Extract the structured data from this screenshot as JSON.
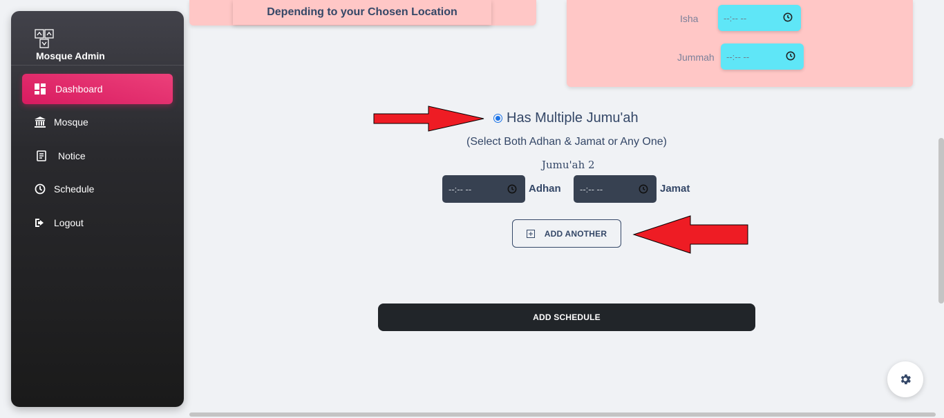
{
  "sidebar": {
    "brand": "Mosque Admin",
    "items": [
      {
        "label": "Dashboard",
        "icon": "dashboard-icon",
        "active": true
      },
      {
        "label": "Mosque",
        "icon": "mosque-icon",
        "active": false
      },
      {
        "label": "Notice",
        "icon": "notice-icon",
        "active": false
      },
      {
        "label": "Schedule",
        "icon": "clock-icon",
        "active": false
      },
      {
        "label": "Logout",
        "icon": "logout-icon",
        "active": false
      }
    ]
  },
  "location_card": {
    "text": "Depending to your Chosen Location"
  },
  "prayer_times": {
    "isha": {
      "label": "Isha",
      "value": "--:-- --"
    },
    "jummah": {
      "label": "Jummah",
      "value": "--:-- --"
    }
  },
  "multiple_jumuah": {
    "label": "Has Multiple Jumu'ah",
    "selected": true,
    "hint": "(Select Both Adhan & Jamat or Any One)",
    "group_title": "Jumu'ah 2",
    "adhan": {
      "label": "Adhan",
      "value": "--:-- --"
    },
    "jamat": {
      "label": "Jamat",
      "value": "--:-- --"
    }
  },
  "buttons": {
    "add_another": "ADD ANOTHER",
    "add_schedule": "ADD SCHEDULE"
  },
  "colors": {
    "accent_pink": "#e91e63",
    "card_pink": "#ffc7c6",
    "time_cyan": "#5fe6f7",
    "arrow_red": "#ee1c24"
  }
}
